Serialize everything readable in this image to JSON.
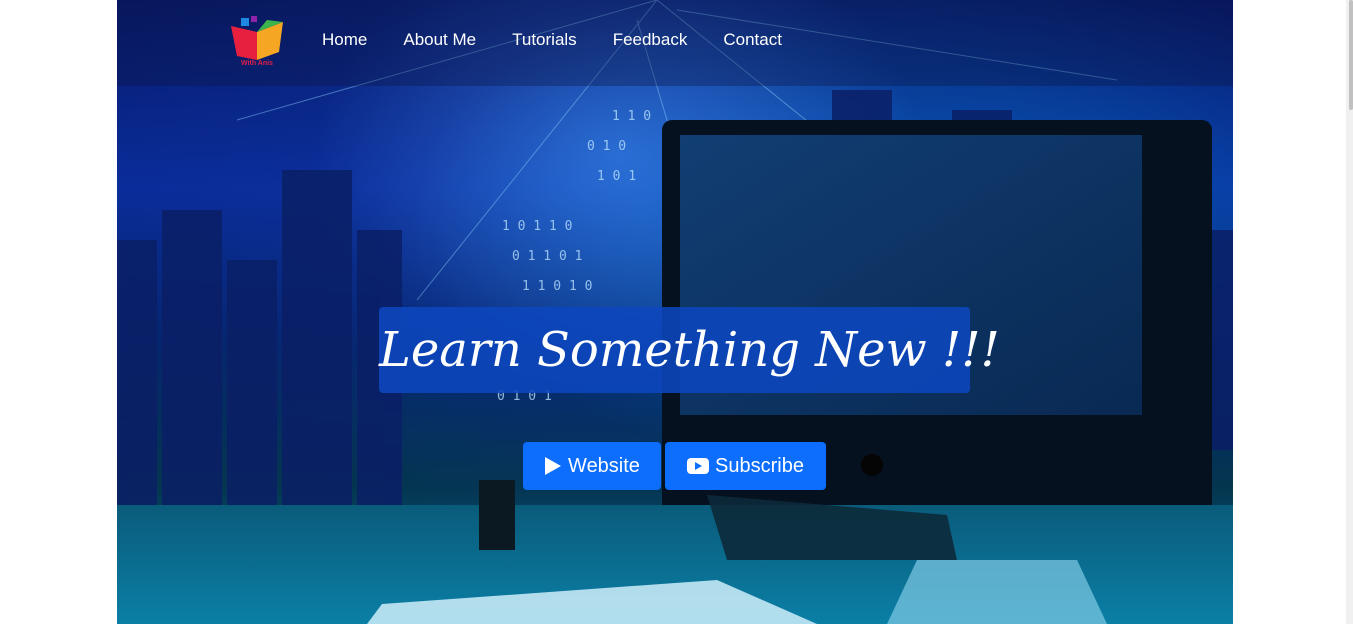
{
  "brand": {
    "logo_text": "With Anis"
  },
  "nav": {
    "items": [
      {
        "label": "Home"
      },
      {
        "label": "About Me"
      },
      {
        "label": "Tutorials"
      },
      {
        "label": "Feedback"
      },
      {
        "label": "Contact"
      }
    ]
  },
  "hero": {
    "title": "Learn Something New !!!",
    "buttons": {
      "website_label": "Website",
      "website_icon": "play-icon",
      "subscribe_label": "Subscribe",
      "subscribe_icon": "youtube-icon"
    }
  },
  "colors": {
    "button_bg": "#0d6efd",
    "title_bg": "#0d47be",
    "nav_text": "#ffffff"
  }
}
